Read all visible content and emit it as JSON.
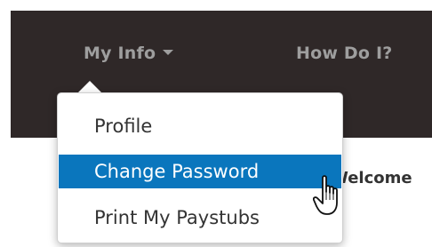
{
  "navbar": {
    "items": [
      {
        "label": "My Info",
        "icon": "caret-down-icon"
      },
      {
        "label": "How Do I?"
      }
    ],
    "background": "#2f2828",
    "text_color": "#9e9e9e"
  },
  "dropdown": {
    "items": [
      {
        "label": "Profile"
      },
      {
        "label": "Change Password",
        "state": "hover"
      },
      {
        "label": "Print My Paystubs"
      }
    ],
    "highlight_color": "#0a76bd"
  },
  "page": {
    "welcome_text": "Welcome"
  },
  "cursor": {
    "icon": "hand-pointer-icon"
  }
}
